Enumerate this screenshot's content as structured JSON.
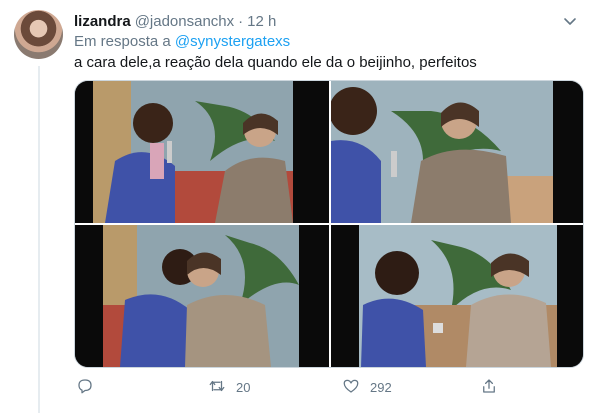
{
  "tweet": {
    "author_name": "lizandra",
    "author_handle": "@jadonsanchx",
    "separator": "·",
    "time": "12 h",
    "reply_prefix": "Em resposta a",
    "reply_mention": "@synystergatexs",
    "text": "a cara dele,a reação dela quando ele da o beijinho, perfeitos"
  },
  "actions": {
    "replies": "",
    "retweets": "20",
    "likes": "292"
  },
  "media": {
    "tiles": [
      "frame-1",
      "frame-2",
      "frame-3",
      "frame-4"
    ]
  },
  "icons": {
    "caret": "chevron-down-icon",
    "reply": "comment-icon",
    "retweet": "retweet-icon",
    "like": "heart-icon",
    "share": "share-icon"
  },
  "colors": {
    "accent": "#1da1f2",
    "secondary_text": "#657786",
    "border": "#ccd6dd"
  }
}
